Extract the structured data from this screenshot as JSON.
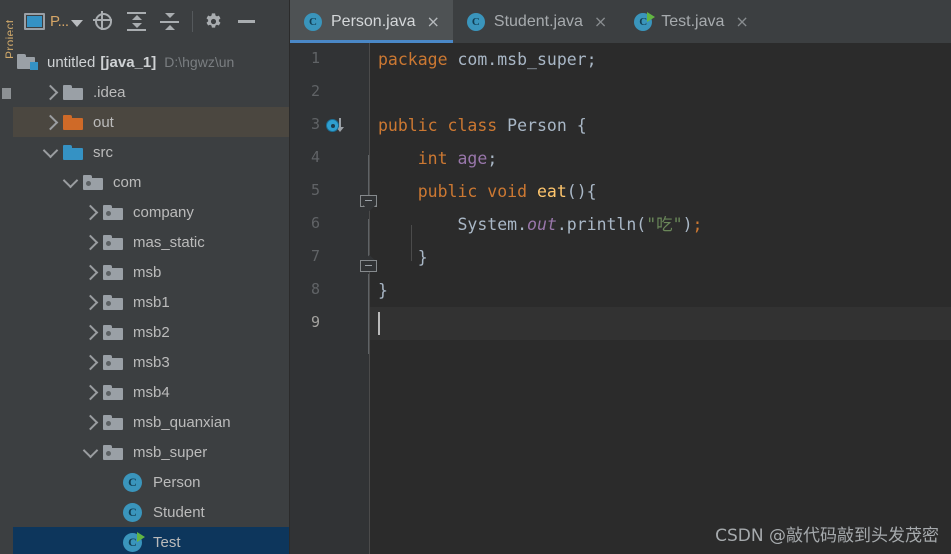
{
  "app": {
    "tool_strip_label": "Project"
  },
  "panel_toolbar": {
    "project_selector_label": "P...",
    "buttons": [
      {
        "name": "project-view-selector",
        "label": "P..."
      },
      {
        "name": "select-opened-file",
        "label": ""
      },
      {
        "name": "expand-all",
        "label": ""
      },
      {
        "name": "collapse-all",
        "label": ""
      },
      {
        "name": "settings",
        "label": ""
      },
      {
        "name": "hide-panel",
        "label": ""
      }
    ]
  },
  "tree": {
    "items": [
      {
        "label": "untitled",
        "module": "[java_1]",
        "path": "D:\\hgwz\\un",
        "icon": "module-icon",
        "indent": 0,
        "arrow": "none",
        "state": "root"
      },
      {
        "label": ".idea",
        "icon": "folder-gray-icon",
        "indent": 1,
        "arrow": "right",
        "state": "normal"
      },
      {
        "label": "out",
        "icon": "folder-orange-icon",
        "indent": 1,
        "arrow": "right",
        "state": "highlight"
      },
      {
        "label": "src",
        "icon": "folder-blue-icon",
        "indent": 1,
        "arrow": "down",
        "state": "normal"
      },
      {
        "label": "com",
        "icon": "package-icon",
        "indent": 2,
        "arrow": "down",
        "state": "normal"
      },
      {
        "label": "company",
        "icon": "package-icon",
        "indent": 3,
        "arrow": "right",
        "state": "normal"
      },
      {
        "label": "mas_static",
        "icon": "package-icon",
        "indent": 3,
        "arrow": "right",
        "state": "normal"
      },
      {
        "label": "msb",
        "icon": "package-icon",
        "indent": 3,
        "arrow": "right",
        "state": "normal"
      },
      {
        "label": "msb1",
        "icon": "package-icon",
        "indent": 3,
        "arrow": "right",
        "state": "normal"
      },
      {
        "label": "msb2",
        "icon": "package-icon",
        "indent": 3,
        "arrow": "right",
        "state": "normal"
      },
      {
        "label": "msb3",
        "icon": "package-icon",
        "indent": 3,
        "arrow": "right",
        "state": "normal"
      },
      {
        "label": "msb4",
        "icon": "package-icon",
        "indent": 3,
        "arrow": "right",
        "state": "normal"
      },
      {
        "label": "msb_quanxian",
        "icon": "package-icon",
        "indent": 3,
        "arrow": "right",
        "state": "normal"
      },
      {
        "label": "msb_super",
        "icon": "package-icon",
        "indent": 3,
        "arrow": "down",
        "state": "normal"
      },
      {
        "label": "Person",
        "icon": "class-icon",
        "indent": 4,
        "arrow": "none",
        "state": "normal"
      },
      {
        "label": "Student",
        "icon": "class-icon",
        "indent": 4,
        "arrow": "none",
        "state": "normal"
      },
      {
        "label": "Test",
        "icon": "runnable-class-icon",
        "indent": 4,
        "arrow": "none",
        "state": "selected"
      }
    ]
  },
  "editor_tabs": [
    {
      "label": "Person.java",
      "icon": "class-icon",
      "active": true,
      "close": "×"
    },
    {
      "label": "Student.java",
      "icon": "class-icon",
      "active": false,
      "close": "×"
    },
    {
      "label": "Test.java",
      "icon": "runnable-class-icon",
      "active": false,
      "close": "×"
    }
  ],
  "editor": {
    "gutter_numbers": [
      "1",
      "2",
      "3",
      "4",
      "5",
      "6",
      "7",
      "8",
      "9"
    ],
    "current_line": 9,
    "gutter_markers": [
      {
        "line": 3,
        "icon": "implemented-by-icon"
      },
      {
        "line": 5,
        "icon": "fold-start-icon"
      },
      {
        "line": 7,
        "icon": "fold-end-icon"
      }
    ],
    "lines": [
      {
        "n": 1,
        "text": "package com.msb_super;"
      },
      {
        "n": 2,
        "text": ""
      },
      {
        "n": 3,
        "text": "public class Person {"
      },
      {
        "n": 4,
        "text": "    int age;"
      },
      {
        "n": 5,
        "text": "    public void eat(){"
      },
      {
        "n": 6,
        "text": "        System.out.println(\"吃\");"
      },
      {
        "n": 7,
        "text": "    }"
      },
      {
        "n": 8,
        "text": "}"
      },
      {
        "n": 9,
        "text": ""
      }
    ],
    "tokens": {
      "l1_kw": "package",
      "l1_name": " com.msb_super;",
      "l3_kw1": "public",
      "l3_kw2": "class",
      "l3_name": "Person",
      "l3_brace": "{",
      "l4_type": "int",
      "l4_field": "age",
      "l4_semi": ";",
      "l5_kw1": "public",
      "l5_kw2": "void",
      "l5_mth": "eat",
      "l5_tail": "(){",
      "l6_sys": "System.",
      "l6_out": "out",
      "l6_dot": ".",
      "l6_println": "println",
      "l6_paren1": "(",
      "l6_str": "\"吃\"",
      "l6_paren2": ")",
      "l6_semi": ";",
      "l7_brace": "}",
      "l8_brace": "}"
    }
  },
  "watermark": {
    "text": "CSDN @敲代码敲到头发茂密"
  },
  "colors": {
    "panel_bg": "#3c3f41",
    "editor_bg": "#2b2b2b",
    "gutter_bg": "#313335",
    "tab_active_bg": "#4e5254",
    "tab_underline": "#4a88c7",
    "selection_blue": "#0d365c",
    "highlight_olive": "#4b4740",
    "keyword": "#cc7832",
    "string": "#6a8759",
    "field": "#9876aa",
    "method": "#ffc66d",
    "plain": "#a9b7c6",
    "accent_teal": "#3a95bc",
    "folder_orange": "#cf6a28",
    "folder_blue": "#3592c4",
    "run_green": "#62b543"
  }
}
